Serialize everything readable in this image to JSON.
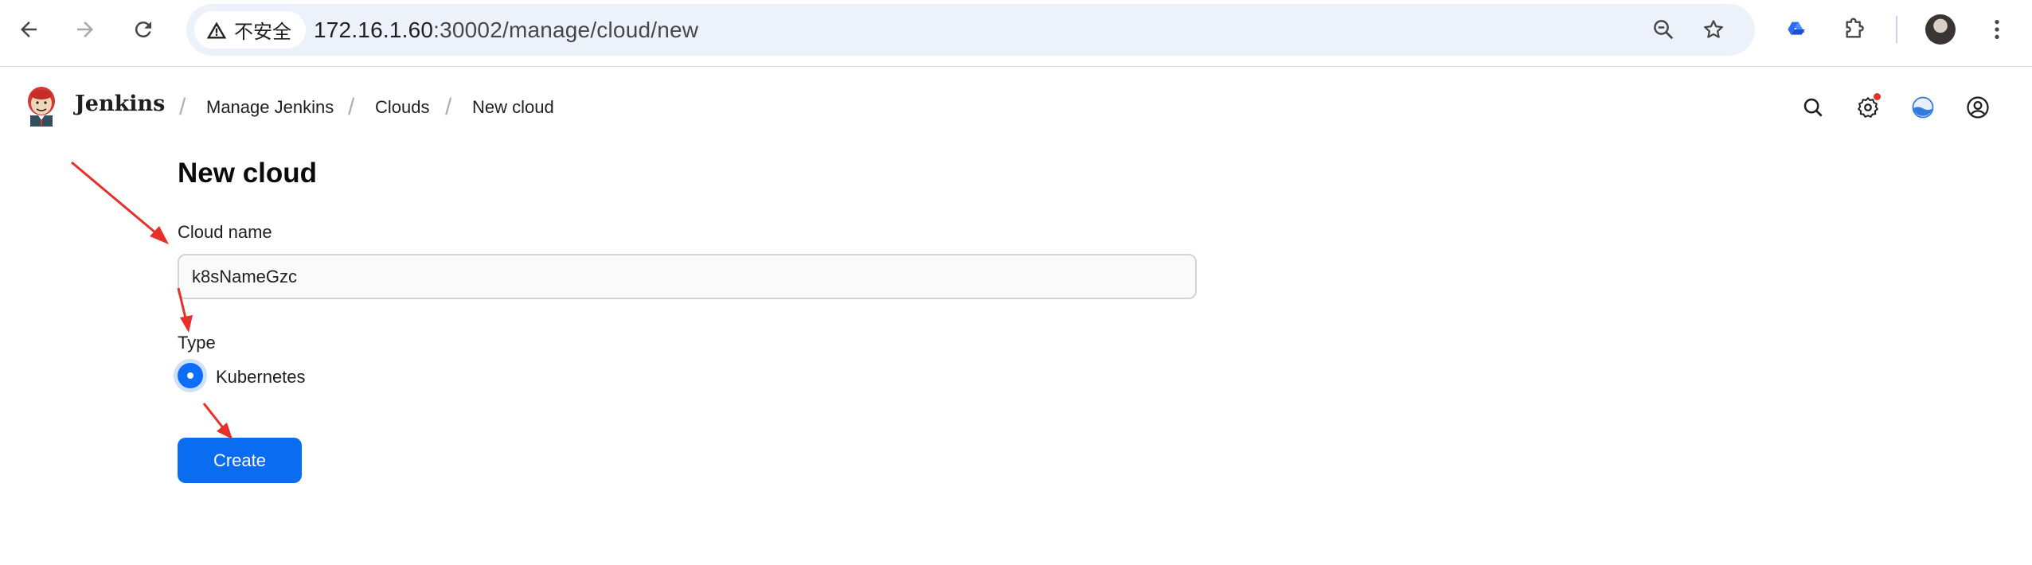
{
  "browser": {
    "security_label": "不安全",
    "url_host": "172.16.1.60",
    "url_path": ":30002/manage/cloud/new",
    "icons": {
      "back": "arrow-left-icon",
      "forward": "arrow-right-icon",
      "reload": "reload-icon",
      "warning": "warning-triangle-icon",
      "zoom": "zoom-out-icon",
      "bookmark": "star-icon",
      "extension1": "drive-triangle-icon",
      "extensions": "puzzle-icon",
      "profile": "avatar",
      "menu": "kebab-menu-icon"
    },
    "colors": {
      "omnibox_bg": "#edf2fa"
    }
  },
  "header": {
    "app_name": "Jenkins",
    "breadcrumbs": [
      "Manage Jenkins",
      "Clouds",
      "New cloud"
    ],
    "icons": [
      "search-icon",
      "gear-icon",
      "theme-icon",
      "account-icon"
    ]
  },
  "main": {
    "title": "New cloud",
    "cloud_name_label": "Cloud name",
    "cloud_name_value": "k8sNameGzc",
    "type_label": "Type",
    "type_option": "Kubernetes",
    "type_selected": true,
    "create_label": "Create"
  },
  "colors": {
    "accent": "#0a6cf0",
    "annotation_arrow": "#e8302a",
    "notification_dot": "#e5302a"
  }
}
